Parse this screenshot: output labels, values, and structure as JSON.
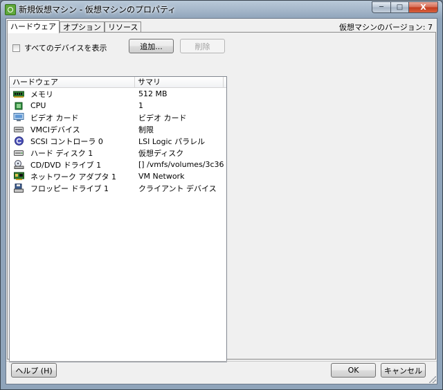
{
  "window": {
    "title": "新規仮想マシン - 仮想マシンのプロパティ",
    "min_glyph": "─",
    "max_glyph": "□",
    "close_glyph": "X"
  },
  "tabs": [
    {
      "label": "ハードウェア",
      "active": true
    },
    {
      "label": "オプション",
      "active": false
    },
    {
      "label": "リソース",
      "active": false
    }
  ],
  "version_label": "仮想マシンのバージョン: 7",
  "show_all_devices_label": "すべてのデバイスを表示",
  "add_button_label": "追加...",
  "remove_button_label": "削除",
  "table": {
    "headers": {
      "hardware": "ハードウェア",
      "summary": "サマリ"
    },
    "rows": [
      {
        "icon": "memory-icon",
        "hardware": "メモリ",
        "summary": "512 MB"
      },
      {
        "icon": "cpu-icon",
        "hardware": "CPU",
        "summary": "1"
      },
      {
        "icon": "video-card-icon",
        "hardware": "ビデオ カード",
        "summary": "ビデオ カード"
      },
      {
        "icon": "vmci-device-icon",
        "hardware": "VMCIデバイス",
        "summary": "制限"
      },
      {
        "icon": "scsi-controller-icon",
        "hardware": "SCSI コントローラ 0",
        "summary": "LSI Logic パラレル"
      },
      {
        "icon": "hard-disk-icon",
        "hardware": "ハード ディスク 1",
        "summary": "仮想ディスク"
      },
      {
        "icon": "cd-dvd-drive-icon",
        "hardware": "CD/DVD ドライブ 1",
        "summary": "[] /vmfs/volumes/3c36..."
      },
      {
        "icon": "network-adapter-icon",
        "hardware": "ネットワーク アダプタ 1",
        "summary": "VM Network"
      },
      {
        "icon": "floppy-drive-icon",
        "hardware": "フロッピー ドライブ 1",
        "summary": "クライアント デバイス"
      }
    ]
  },
  "footer": {
    "help_label": "ヘルプ (H)",
    "ok_label": "OK",
    "cancel_label": "キャンセル"
  },
  "colors": {
    "titlebar": "#a4b6c9",
    "close_button": "#c2391c",
    "panel_background": "#f0f0f0"
  }
}
